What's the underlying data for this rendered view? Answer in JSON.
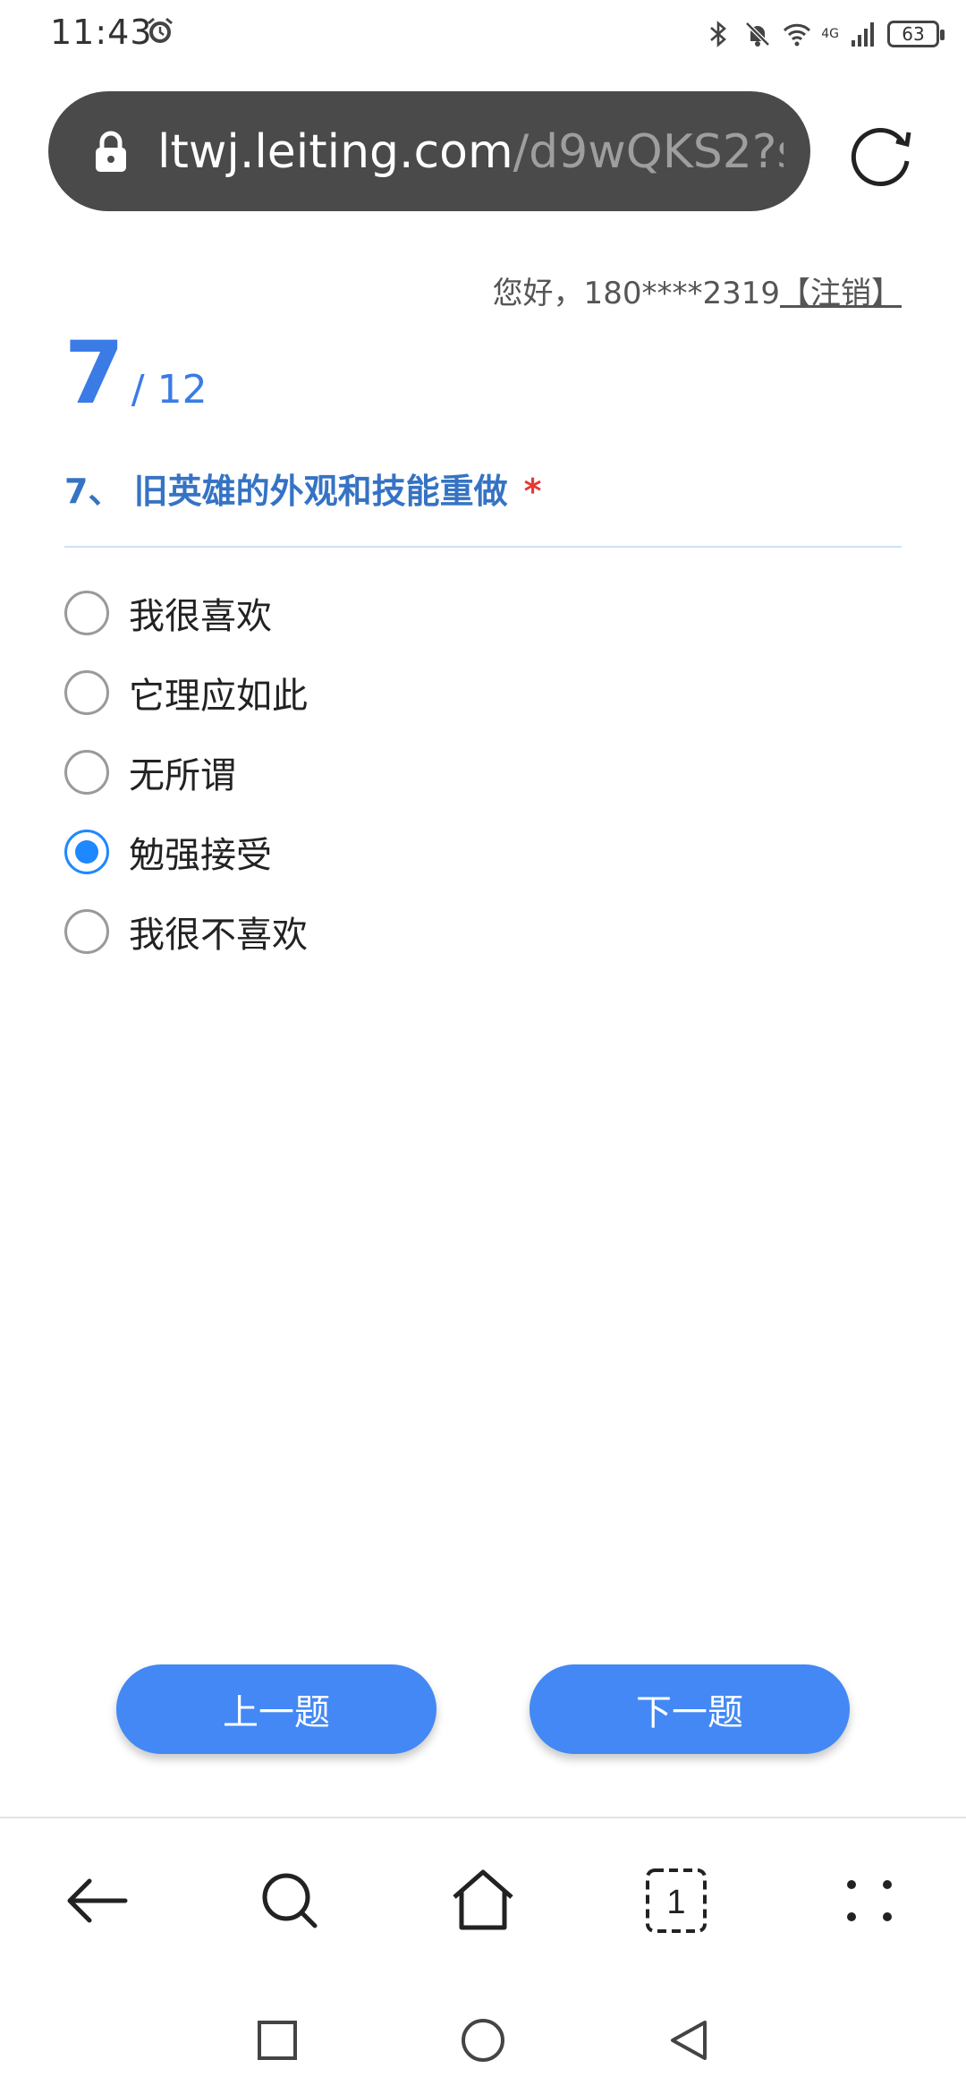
{
  "status_bar": {
    "time": "11:43",
    "network": "4G",
    "battery": "63",
    "icons": [
      "alarm-icon",
      "bluetooth-icon",
      "mute-bell-icon",
      "wifi-icon",
      "signal-icon",
      "battery-icon"
    ]
  },
  "browser": {
    "url_host": "ltwj.leiting.com",
    "url_path": "/d9wQKS2?sig",
    "lock_icon": "lock-icon",
    "reload_icon": "reload-icon"
  },
  "header": {
    "greeting": "您好，180****2319",
    "logout": "【注销】"
  },
  "progress": {
    "current": "7",
    "total": "/ 12"
  },
  "question": {
    "title": "7、 旧英雄的外观和技能重做",
    "required_mark": "*"
  },
  "options": [
    {
      "label": "我很喜欢",
      "selected": false
    },
    {
      "label": "它理应如此",
      "selected": false
    },
    {
      "label": "无所谓",
      "selected": false
    },
    {
      "label": "勉强接受",
      "selected": true
    },
    {
      "label": "我很不喜欢",
      "selected": false
    }
  ],
  "buttons": {
    "prev": "上一题",
    "next": "下一题"
  },
  "toolbar": {
    "tabs_count": "1",
    "items": [
      "back-icon",
      "search-icon",
      "home-icon",
      "tabs-icon",
      "menu-icon"
    ]
  },
  "navbar": {
    "items": [
      "recent-apps-icon",
      "home-circle-icon",
      "back-triangle-icon"
    ]
  },
  "colors": {
    "accent": "#3b7be6",
    "button": "#4388f5",
    "radio_selected": "#1e88ff",
    "required": "#e53935",
    "url_bar": "#4a4a4a"
  }
}
